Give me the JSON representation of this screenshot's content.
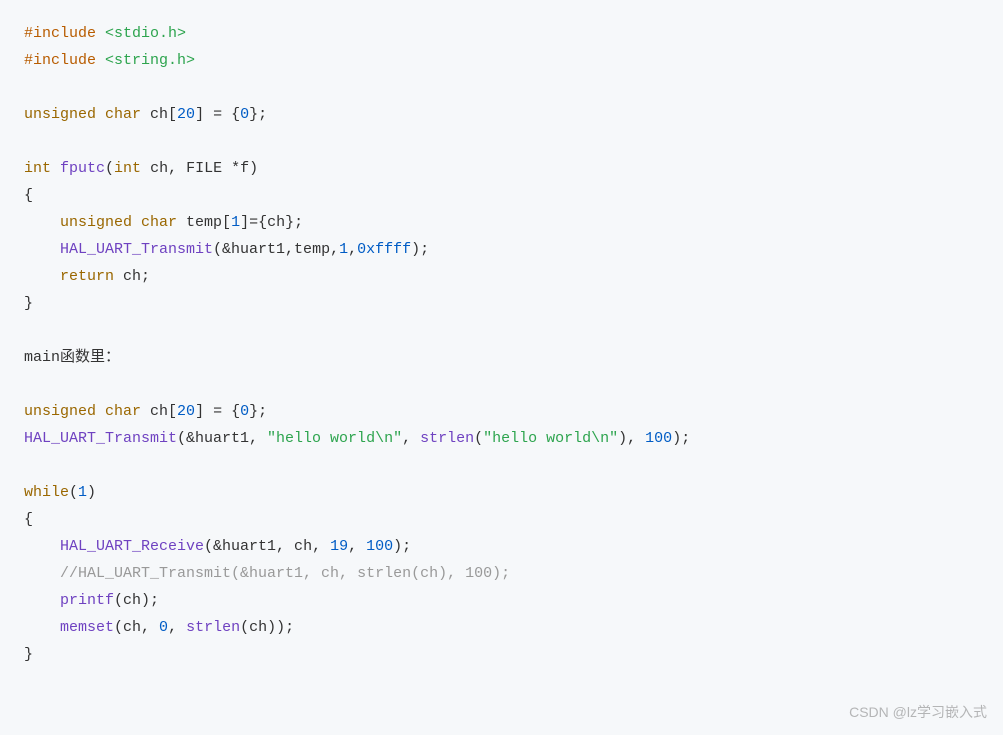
{
  "code": {
    "l1_preproc": "#include",
    "l1_str": " <stdio.h>",
    "l2_preproc": "#include",
    "l2_str": " <string.h>",
    "l4_kw1": "unsigned",
    "l4_kw2": " char",
    "l4_id": " ch[",
    "l4_num1": "20",
    "l4_mid": "] = {",
    "l4_num2": "0",
    "l4_end": "};",
    "l6_kw1": "int",
    "l6_fn": " fputc",
    "l6_p1": "(",
    "l6_kw2": "int",
    "l6_id1": " ch, FILE *f)",
    "l7": "{",
    "l8_indent": "    ",
    "l8_kw1": "unsigned",
    "l8_kw2": " char",
    "l8_id": " temp[",
    "l8_num": "1",
    "l8_end": "]={ch};",
    "l9_indent": "    ",
    "l9_fn": "HAL_UART_Transmit",
    "l9_args": "(&huart1,temp,",
    "l9_num1": "1",
    "l9_comma": ",",
    "l9_num2": "0xffff",
    "l9_end": ");",
    "l10_indent": "    ",
    "l10_kw": "return",
    "l10_id": " ch;",
    "l11": "}",
    "l13": "main函数里：",
    "l15_kw1": "unsigned",
    "l15_kw2": " char",
    "l15_id": " ch[",
    "l15_num1": "20",
    "l15_mid": "] = {",
    "l15_num2": "0",
    "l15_end": "};",
    "l16_fn": "HAL_UART_Transmit",
    "l16_p1": "(&huart1, ",
    "l16_str1": "\"hello world\\n\"",
    "l16_p2": ", ",
    "l16_fn2": "strlen",
    "l16_p3": "(",
    "l16_str2": "\"hello world\\n\"",
    "l16_p4": "), ",
    "l16_num": "100",
    "l16_end": ");",
    "l18_kw": "while",
    "l18_p1": "(",
    "l18_num": "1",
    "l18_p2": ")",
    "l19": "{",
    "l20_indent": "    ",
    "l20_fn": "HAL_UART_Receive",
    "l20_p1": "(&huart1, ch, ",
    "l20_num1": "19",
    "l20_p2": ", ",
    "l20_num2": "100",
    "l20_end": ");",
    "l21_indent": "    ",
    "l21_comment": "//HAL_UART_Transmit(&huart1, ch, strlen(ch), 100);",
    "l22_indent": "    ",
    "l22_fn": "printf",
    "l22_args": "(ch);",
    "l23_indent": "    ",
    "l23_fn": "memset",
    "l23_p1": "(ch, ",
    "l23_num": "0",
    "l23_p2": ", ",
    "l23_fn2": "strlen",
    "l23_p3": "(ch));",
    "l24": "}"
  },
  "watermark": "CSDN @lz学习嵌入式"
}
